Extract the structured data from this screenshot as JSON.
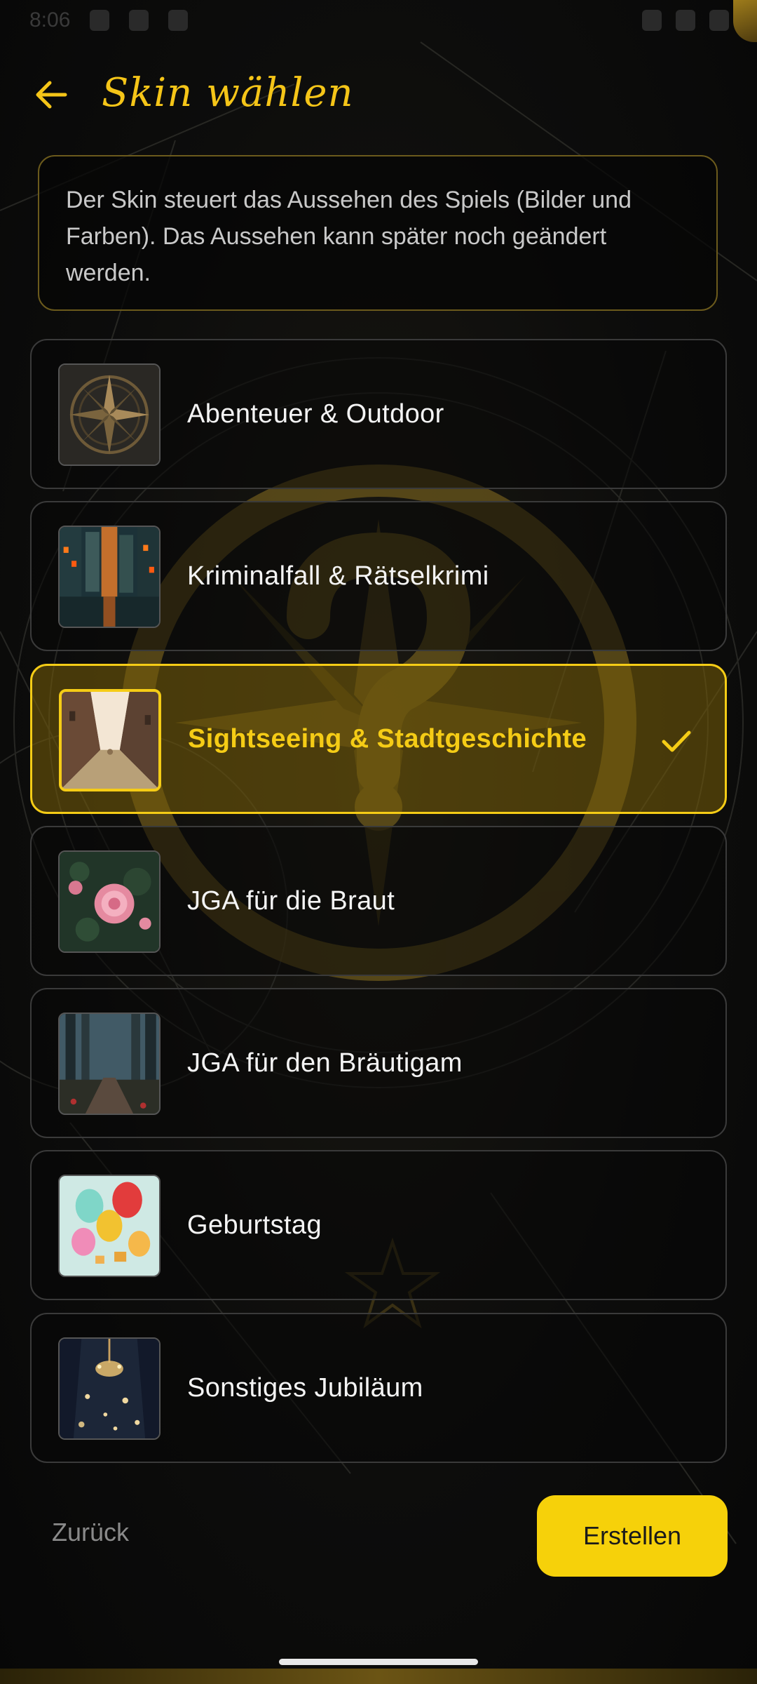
{
  "status_bar": {
    "time": "8:06"
  },
  "header": {
    "title": "Skin wählen",
    "back_icon": "arrow-left-icon"
  },
  "info": {
    "text": "Der Skin steuert das Aussehen des Spiels (Bilder und Farben). Das Aussehen kann später noch geändert werden."
  },
  "skins": [
    {
      "label": "Abenteuer & Outdoor",
      "thumb": "compass-image",
      "selected": false
    },
    {
      "label": "Kriminalfall & Rätselkrimi",
      "thumb": "rainy-city-image",
      "selected": false
    },
    {
      "label": "Sightseeing & Stadtgeschichte",
      "thumb": "old-town-alley-image",
      "selected": true
    },
    {
      "label": "JGA für die Braut",
      "thumb": "roses-image",
      "selected": false
    },
    {
      "label": "JGA für den Bräutigam",
      "thumb": "forest-path-image",
      "selected": false
    },
    {
      "label": "Geburtstag",
      "thumb": "balloons-image",
      "selected": false
    },
    {
      "label": "Sonstiges Jubiläum",
      "thumb": "chandelier-image",
      "selected": false
    }
  ],
  "footer": {
    "back_label": "Zurück",
    "create_label": "Erstellen"
  },
  "colors": {
    "accent": "#f5cc16",
    "background": "#0b0b0b",
    "text": "#f4f4f4"
  }
}
